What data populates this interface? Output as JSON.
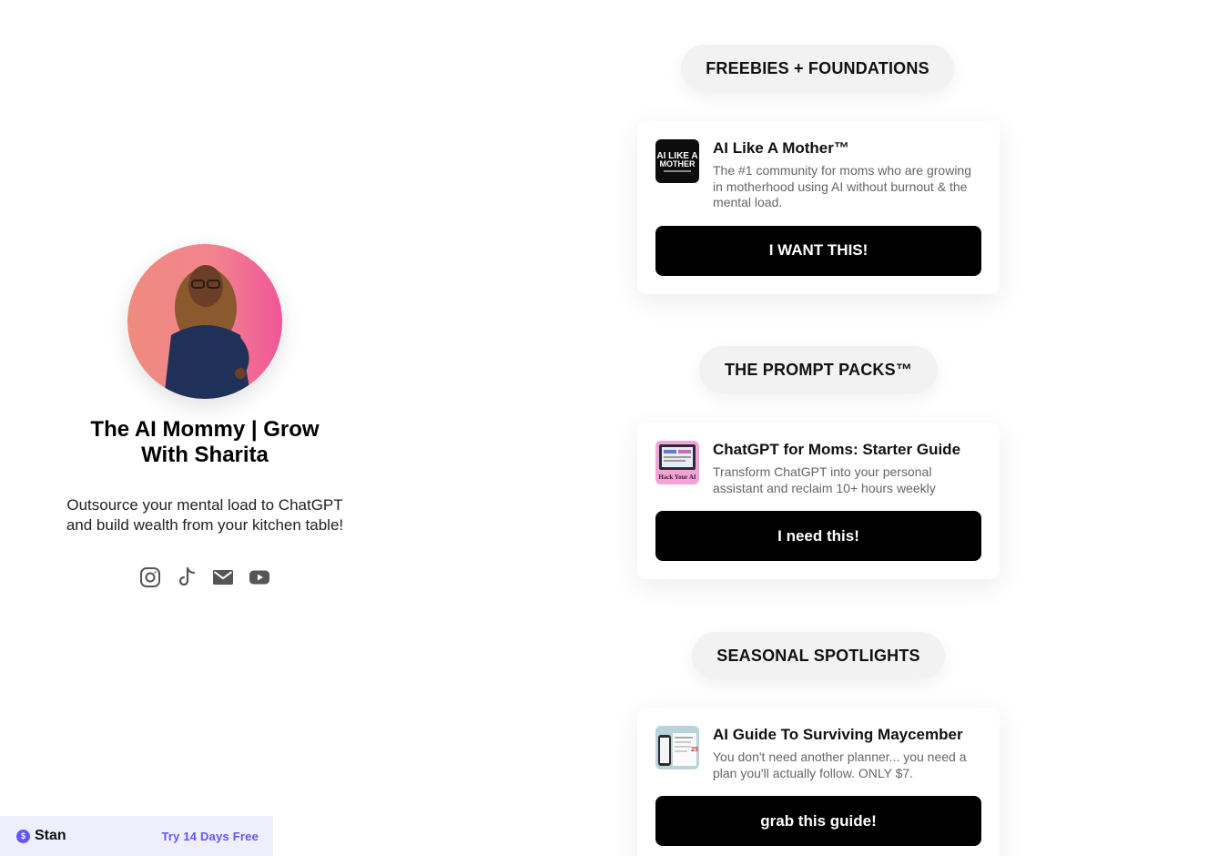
{
  "profile": {
    "name": "The AI Mommy | Grow With Sharita",
    "bio": "Outsource your mental load to ChatGPT and build wealth from your kitchen table!",
    "socials": [
      {
        "icon": "instagram-icon"
      },
      {
        "icon": "tiktok-icon"
      },
      {
        "icon": "mail-icon"
      },
      {
        "icon": "youtube-icon"
      }
    ]
  },
  "sections": [
    {
      "heading": "FREEBIES + FOUNDATIONS",
      "card": {
        "title": "AI Like A Mother™",
        "description": "The #1 community for moms who are growing in motherhood using AI without burnout & the mental load.",
        "button": "I WANT THIS!",
        "thumb_text": "AI LIKE A MOTHER"
      }
    },
    {
      "heading": "THE PROMPT PACKS™",
      "card": {
        "title": "ChatGPT for Moms: Starter Guide",
        "description": "Transform ChatGPT into your personal assistant and reclaim 10+ hours weekly",
        "button": "I need this!",
        "thumb_text": "Hack Your AI"
      }
    },
    {
      "heading": "SEASONAL SPOTLIGHTS",
      "card": {
        "title": "AI Guide To Surviving Maycember",
        "description": "You don't need another planner... you need a plan you'll actually follow. ONLY $7.",
        "button": "grab this guide!",
        "thumb_text": "25"
      }
    }
  ],
  "footer": {
    "brand": "Stan",
    "cta": "Try 14 Days Free"
  },
  "colors": {
    "accent": "#6355ff",
    "button": "#000000",
    "pill_bg": "#f2f2f2"
  }
}
